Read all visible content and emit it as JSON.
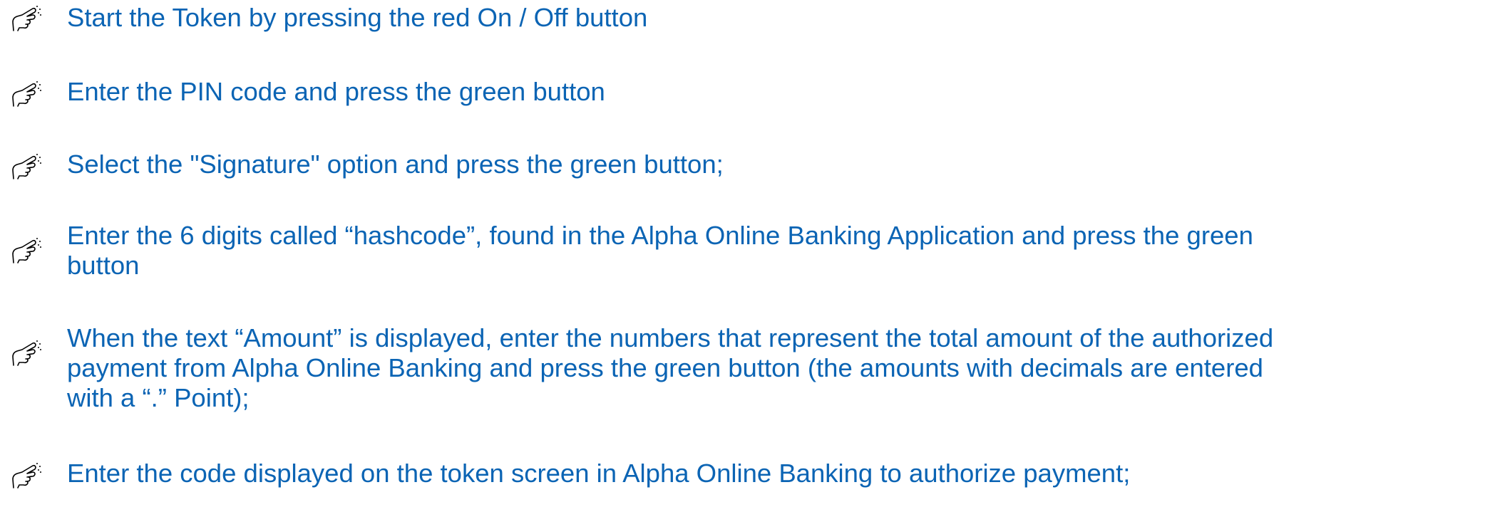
{
  "document": {
    "accent_color": "#0b64b4",
    "bullet_icon": "pointing-hand-icon",
    "steps": [
      {
        "lines": [
          "Start the Token by pressing the red On / Off button"
        ]
      },
      {
        "lines": [
          "Enter the PIN code and press the green button"
        ]
      },
      {
        "lines": [
          "Select the \"Signature\" option and press the green button;"
        ]
      },
      {
        "lines": [
          "Enter the 6 digits called “hashcode”, found in the Alpha Online Banking Application and press the green",
          "button"
        ]
      },
      {
        "lines": [
          "When the text “Amount” is displayed, enter the numbers that represent the total amount of the authorized",
          "payment from Alpha Online Banking and press the green button (the amounts with decimals are entered",
          "with a “.” Point);"
        ]
      },
      {
        "lines": [
          "Enter the code displayed on the token screen in Alpha Online Banking to authorize payment;"
        ]
      }
    ]
  }
}
